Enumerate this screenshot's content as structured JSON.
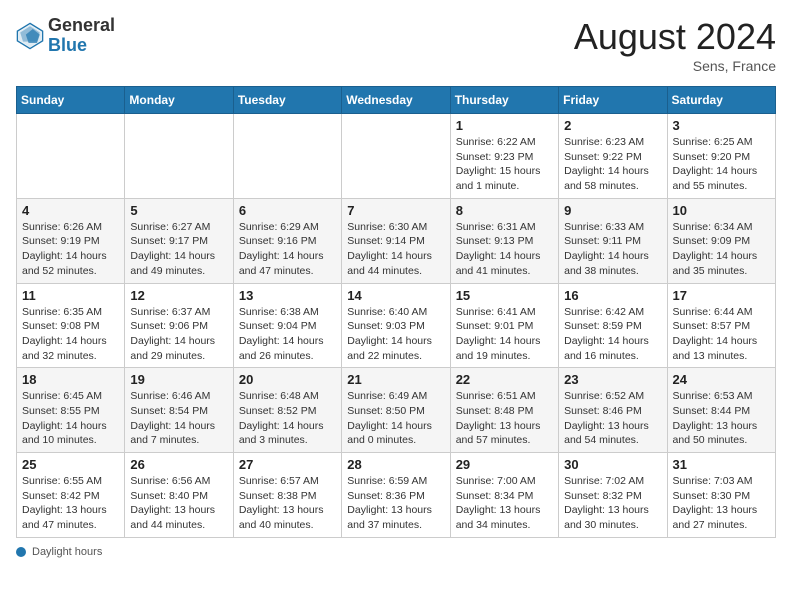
{
  "header": {
    "logo": {
      "general": "General",
      "blue": "Blue"
    },
    "title": "August 2024",
    "location": "Sens, France"
  },
  "calendar": {
    "days_of_week": [
      "Sunday",
      "Monday",
      "Tuesday",
      "Wednesday",
      "Thursday",
      "Friday",
      "Saturday"
    ],
    "weeks": [
      [
        {
          "day": "",
          "detail": ""
        },
        {
          "day": "",
          "detail": ""
        },
        {
          "day": "",
          "detail": ""
        },
        {
          "day": "",
          "detail": ""
        },
        {
          "day": "1",
          "detail": "Sunrise: 6:22 AM\nSunset: 9:23 PM\nDaylight: 15 hours and 1 minute."
        },
        {
          "day": "2",
          "detail": "Sunrise: 6:23 AM\nSunset: 9:22 PM\nDaylight: 14 hours and 58 minutes."
        },
        {
          "day": "3",
          "detail": "Sunrise: 6:25 AM\nSunset: 9:20 PM\nDaylight: 14 hours and 55 minutes."
        }
      ],
      [
        {
          "day": "4",
          "detail": "Sunrise: 6:26 AM\nSunset: 9:19 PM\nDaylight: 14 hours and 52 minutes."
        },
        {
          "day": "5",
          "detail": "Sunrise: 6:27 AM\nSunset: 9:17 PM\nDaylight: 14 hours and 49 minutes."
        },
        {
          "day": "6",
          "detail": "Sunrise: 6:29 AM\nSunset: 9:16 PM\nDaylight: 14 hours and 47 minutes."
        },
        {
          "day": "7",
          "detail": "Sunrise: 6:30 AM\nSunset: 9:14 PM\nDaylight: 14 hours and 44 minutes."
        },
        {
          "day": "8",
          "detail": "Sunrise: 6:31 AM\nSunset: 9:13 PM\nDaylight: 14 hours and 41 minutes."
        },
        {
          "day": "9",
          "detail": "Sunrise: 6:33 AM\nSunset: 9:11 PM\nDaylight: 14 hours and 38 minutes."
        },
        {
          "day": "10",
          "detail": "Sunrise: 6:34 AM\nSunset: 9:09 PM\nDaylight: 14 hours and 35 minutes."
        }
      ],
      [
        {
          "day": "11",
          "detail": "Sunrise: 6:35 AM\nSunset: 9:08 PM\nDaylight: 14 hours and 32 minutes."
        },
        {
          "day": "12",
          "detail": "Sunrise: 6:37 AM\nSunset: 9:06 PM\nDaylight: 14 hours and 29 minutes."
        },
        {
          "day": "13",
          "detail": "Sunrise: 6:38 AM\nSunset: 9:04 PM\nDaylight: 14 hours and 26 minutes."
        },
        {
          "day": "14",
          "detail": "Sunrise: 6:40 AM\nSunset: 9:03 PM\nDaylight: 14 hours and 22 minutes."
        },
        {
          "day": "15",
          "detail": "Sunrise: 6:41 AM\nSunset: 9:01 PM\nDaylight: 14 hours and 19 minutes."
        },
        {
          "day": "16",
          "detail": "Sunrise: 6:42 AM\nSunset: 8:59 PM\nDaylight: 14 hours and 16 minutes."
        },
        {
          "day": "17",
          "detail": "Sunrise: 6:44 AM\nSunset: 8:57 PM\nDaylight: 14 hours and 13 minutes."
        }
      ],
      [
        {
          "day": "18",
          "detail": "Sunrise: 6:45 AM\nSunset: 8:55 PM\nDaylight: 14 hours and 10 minutes."
        },
        {
          "day": "19",
          "detail": "Sunrise: 6:46 AM\nSunset: 8:54 PM\nDaylight: 14 hours and 7 minutes."
        },
        {
          "day": "20",
          "detail": "Sunrise: 6:48 AM\nSunset: 8:52 PM\nDaylight: 14 hours and 3 minutes."
        },
        {
          "day": "21",
          "detail": "Sunrise: 6:49 AM\nSunset: 8:50 PM\nDaylight: 14 hours and 0 minutes."
        },
        {
          "day": "22",
          "detail": "Sunrise: 6:51 AM\nSunset: 8:48 PM\nDaylight: 13 hours and 57 minutes."
        },
        {
          "day": "23",
          "detail": "Sunrise: 6:52 AM\nSunset: 8:46 PM\nDaylight: 13 hours and 54 minutes."
        },
        {
          "day": "24",
          "detail": "Sunrise: 6:53 AM\nSunset: 8:44 PM\nDaylight: 13 hours and 50 minutes."
        }
      ],
      [
        {
          "day": "25",
          "detail": "Sunrise: 6:55 AM\nSunset: 8:42 PM\nDaylight: 13 hours and 47 minutes."
        },
        {
          "day": "26",
          "detail": "Sunrise: 6:56 AM\nSunset: 8:40 PM\nDaylight: 13 hours and 44 minutes."
        },
        {
          "day": "27",
          "detail": "Sunrise: 6:57 AM\nSunset: 8:38 PM\nDaylight: 13 hours and 40 minutes."
        },
        {
          "day": "28",
          "detail": "Sunrise: 6:59 AM\nSunset: 8:36 PM\nDaylight: 13 hours and 37 minutes."
        },
        {
          "day": "29",
          "detail": "Sunrise: 7:00 AM\nSunset: 8:34 PM\nDaylight: 13 hours and 34 minutes."
        },
        {
          "day": "30",
          "detail": "Sunrise: 7:02 AM\nSunset: 8:32 PM\nDaylight: 13 hours and 30 minutes."
        },
        {
          "day": "31",
          "detail": "Sunrise: 7:03 AM\nSunset: 8:30 PM\nDaylight: 13 hours and 27 minutes."
        }
      ]
    ]
  },
  "footer": {
    "label": "Daylight hours"
  }
}
